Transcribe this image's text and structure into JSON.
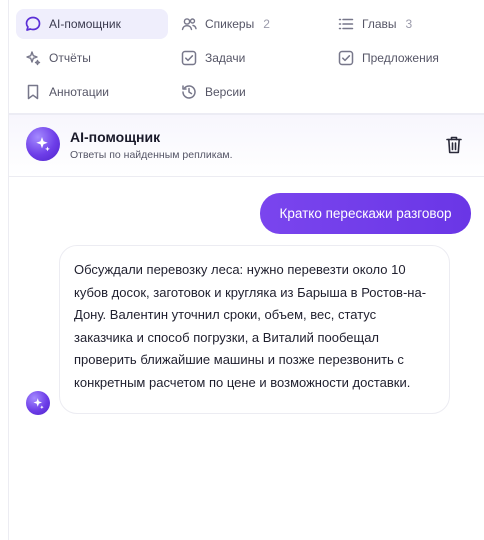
{
  "tabs": [
    {
      "label": "AI-помощник",
      "count": "",
      "icon": "chat-bubble-icon",
      "active": true
    },
    {
      "label": "Спикеры",
      "count": "2",
      "icon": "users-icon",
      "active": false
    },
    {
      "label": "Главы",
      "count": "3",
      "icon": "list-icon",
      "active": false
    },
    {
      "label": "Отчёты",
      "count": "",
      "icon": "sparkles-icon",
      "active": false
    },
    {
      "label": "Задачи",
      "count": "",
      "icon": "checkbox-icon",
      "active": false
    },
    {
      "label": "Предложения",
      "count": "",
      "icon": "checkbox-icon",
      "active": false
    },
    {
      "label": "Аннотации",
      "count": "",
      "icon": "bookmark-icon",
      "active": false
    },
    {
      "label": "Версии",
      "count": "",
      "icon": "history-icon",
      "active": false
    }
  ],
  "assistant": {
    "title": "AI-помощник",
    "subtitle": "Ответы по найденным репликам.",
    "delete_icon": "trash-icon"
  },
  "messages": {
    "user": "Кратко перескажи разговор",
    "bot": "Обсуждали перевозку леса: нужно перевезти около 10 кубов досок, заготовок и кругляка из Барыша в Ростов-на-Дону. Валентин уточнил сроки, объем, вес, статус заказчика и способ погрузки, а Виталий пообещал проверить ближайшие машины и позже перезвонить с конкретным расчетом по цене и возможности доставки."
  },
  "colors": {
    "accent": "#6d3de8",
    "active_tab_bg": "#efeefc",
    "user_bubble": "#7a45ee"
  }
}
